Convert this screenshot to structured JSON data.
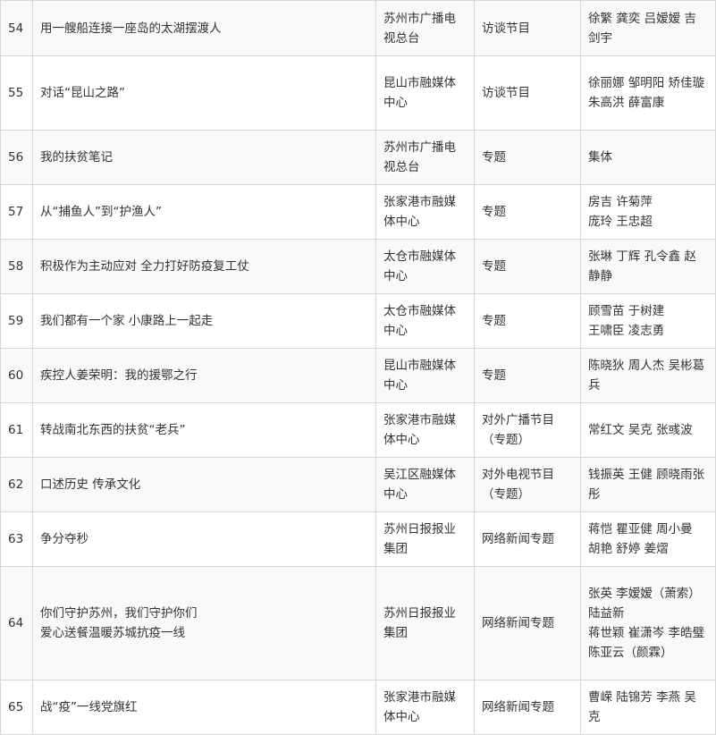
{
  "rows": [
    {
      "num": "54",
      "title": [
        "用一艘船连接一座岛的太湖摆渡人"
      ],
      "org": "苏州市广播电视总台",
      "category": "访谈节目",
      "authors": [
        "徐繁 龚奕 吕嫒嫒 吉剑宇"
      ]
    },
    {
      "num": "55",
      "title": [
        "对话“昆山之路”"
      ],
      "org": "昆山市融媒体中心",
      "category": "访谈节目",
      "authors": [
        "徐丽娜 邹明阳 矫佳璇",
        "朱高洪 薛富康"
      ]
    },
    {
      "num": "56",
      "title": [
        "我的扶贫笔记"
      ],
      "org": "苏州市广播电视总台",
      "category": "专题",
      "authors": [
        "集体"
      ]
    },
    {
      "num": "57",
      "title": [
        "从“捕鱼人”到“护渔人”"
      ],
      "org": "张家港市融媒体中心",
      "category": "专题",
      "authors": [
        "房吉 许菊萍",
        "庞玲 王忠超"
      ]
    },
    {
      "num": "58",
      "title": [
        "积极作为主动应对 全力打好防疫复工仗"
      ],
      "org": "太仓市融媒体中心",
      "category": "专题",
      "authors": [
        "张琳 丁辉 孔令鑫 赵静静"
      ]
    },
    {
      "num": "59",
      "title": [
        "我们都有一个家 小康路上一起走"
      ],
      "org": "太仓市融媒体中心",
      "category": "专题",
      "authors": [
        "顾雪苗 于树建",
        "王啸臣 凌志勇"
      ]
    },
    {
      "num": "60",
      "title": [
        "疾控人姜荣明：我的援鄂之行"
      ],
      "org": "昆山市融媒体中心",
      "category": "专题",
      "authors": [
        "陈晓狄 周人杰 吴彬葛兵"
      ]
    },
    {
      "num": "61",
      "title": [
        "转战南北东西的扶贫“老兵”"
      ],
      "org": "张家港市融媒体中心",
      "category": "对外广播节目（专题）",
      "authors": [
        "常红文 吴克 张彧波"
      ]
    },
    {
      "num": "62",
      "title": [
        "口述历史 传承文化"
      ],
      "org": "吴江区融媒体中心",
      "category": "对外电视节目（专题）",
      "authors": [
        "钱振英 王健 顾晓雨张彤"
      ]
    },
    {
      "num": "63",
      "title": [
        "争分夺秒"
      ],
      "org": "苏州日报报业集团",
      "category": "网络新闻专题",
      "authors": [
        "蒋恺 瞿亚健 周小曼",
        "胡艳 舒婷 姜熠"
      ]
    },
    {
      "num": "64",
      "title": [
        "你们守护苏州，我们守护你们",
        "爱心送餐温暖苏城抗疫一线"
      ],
      "org": "苏州日报报业集团",
      "category": "网络新闻专题",
      "authors": [
        "张英 李嫒嫒（萧索）陆益新",
        "蒋世颖 崔潇岑 李皓璧",
        "陈亚云（颜霖）"
      ]
    },
    {
      "num": "65",
      "title": [
        "战“疫”一线党旗红"
      ],
      "org": "张家港市融媒体中心",
      "category": "网络新闻专题",
      "authors": [
        "曹嵘 陆锦芳 李燕 吴克"
      ]
    }
  ]
}
